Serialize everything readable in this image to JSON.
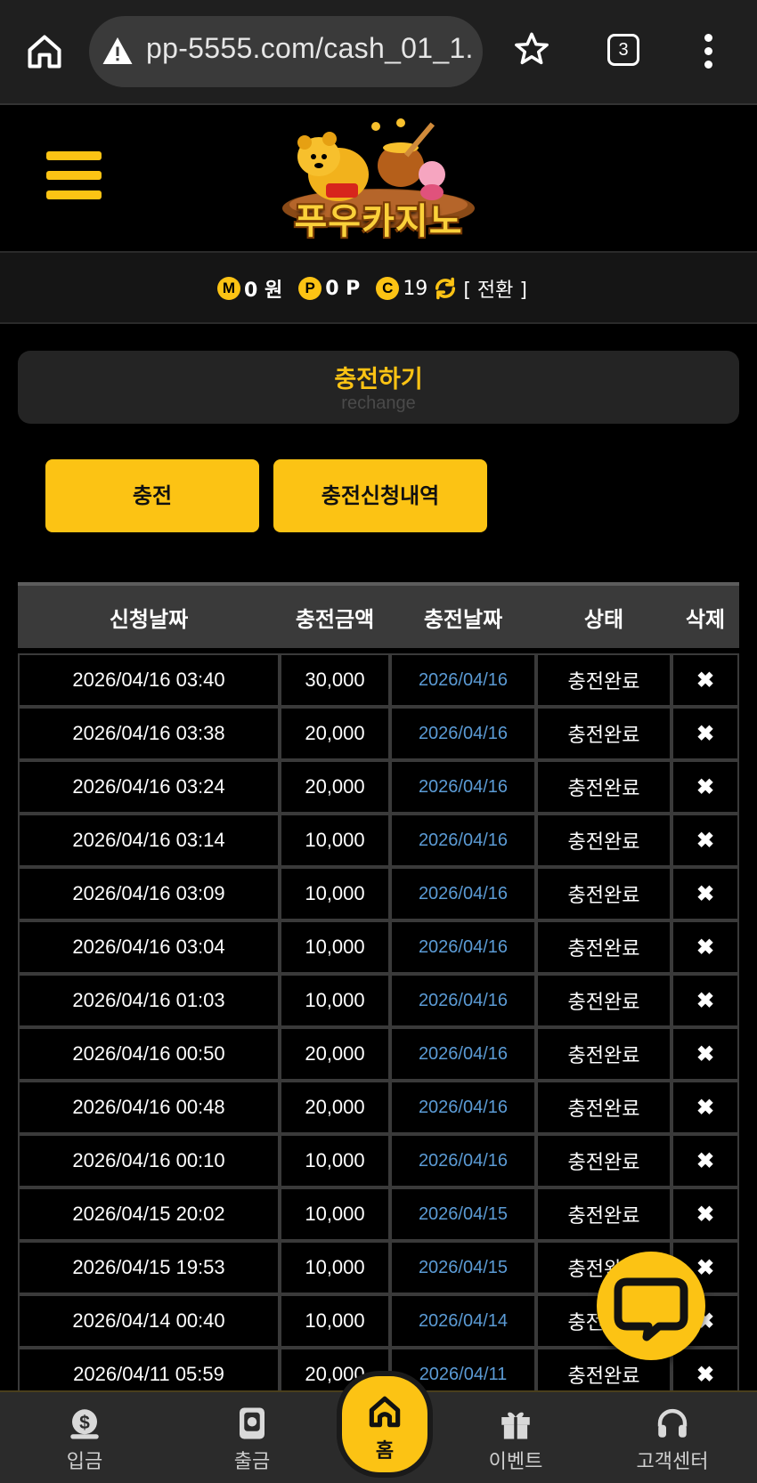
{
  "browser": {
    "url": "pp-5555.com/cash_01_1.",
    "tab_count": "3"
  },
  "site": {
    "logo_text": "푸우카지노"
  },
  "balance": {
    "money_icon": "M",
    "money_value": "0 원",
    "point_icon": "P",
    "point_value": "0 P",
    "coupon_icon": "C",
    "coupon_value": "19",
    "convert_label": "[ 전환 ]"
  },
  "page": {
    "title": "충전하기",
    "subtitle": "rechange"
  },
  "tabs": {
    "charge_label": "충전",
    "history_label": "충전신청내역"
  },
  "table": {
    "headers": [
      "신청날짜",
      "충전금액",
      "충전날짜",
      "상태",
      "삭제"
    ],
    "rows": [
      {
        "request_date": "2026/04/16 03:40",
        "amount": "30,000",
        "charge_date": "2026/04/16",
        "status": "충전완료",
        "delete": "✖"
      },
      {
        "request_date": "2026/04/16 03:38",
        "amount": "20,000",
        "charge_date": "2026/04/16",
        "status": "충전완료",
        "delete": "✖"
      },
      {
        "request_date": "2026/04/16 03:24",
        "amount": "20,000",
        "charge_date": "2026/04/16",
        "status": "충전완료",
        "delete": "✖"
      },
      {
        "request_date": "2026/04/16 03:14",
        "amount": "10,000",
        "charge_date": "2026/04/16",
        "status": "충전완료",
        "delete": "✖"
      },
      {
        "request_date": "2026/04/16 03:09",
        "amount": "10,000",
        "charge_date": "2026/04/16",
        "status": "충전완료",
        "delete": "✖"
      },
      {
        "request_date": "2026/04/16 03:04",
        "amount": "10,000",
        "charge_date": "2026/04/16",
        "status": "충전완료",
        "delete": "✖"
      },
      {
        "request_date": "2026/04/16 01:03",
        "amount": "10,000",
        "charge_date": "2026/04/16",
        "status": "충전완료",
        "delete": "✖"
      },
      {
        "request_date": "2026/04/16 00:50",
        "amount": "20,000",
        "charge_date": "2026/04/16",
        "status": "충전완료",
        "delete": "✖"
      },
      {
        "request_date": "2026/04/16 00:48",
        "amount": "20,000",
        "charge_date": "2026/04/16",
        "status": "충전완료",
        "delete": "✖"
      },
      {
        "request_date": "2026/04/16 00:10",
        "amount": "10,000",
        "charge_date": "2026/04/16",
        "status": "충전완료",
        "delete": "✖"
      },
      {
        "request_date": "2026/04/15 20:02",
        "amount": "10,000",
        "charge_date": "2026/04/15",
        "status": "충전완료",
        "delete": "✖"
      },
      {
        "request_date": "2026/04/15 19:53",
        "amount": "10,000",
        "charge_date": "2026/04/15",
        "status": "충전완료",
        "delete": "✖"
      },
      {
        "request_date": "2026/04/14 00:40",
        "amount": "10,000",
        "charge_date": "2026/04/14",
        "status": "충전완료",
        "delete": "✖"
      },
      {
        "request_date": "2026/04/11 05:59",
        "amount": "20,000",
        "charge_date": "2026/04/11",
        "status": "충전완료",
        "delete": "✖"
      }
    ]
  },
  "bottom_nav": {
    "deposit": "입금",
    "withdraw": "출금",
    "home": "홈",
    "event": "이벤트",
    "support": "고객센터"
  },
  "colors": {
    "accent": "#fcc314",
    "date_link": "#5b9bd5",
    "background": "#000000"
  },
  "icons": {
    "browser_home": "home-icon",
    "url_warning": "warning-icon",
    "bookmark": "star-icon",
    "tabs": "tabs-icon",
    "browser_menu": "more-vert-icon",
    "site_menu": "hamburger-icon",
    "refresh": "refresh-icon",
    "chat": "chat-icon",
    "deposit": "money-bag-icon",
    "withdraw": "wallet-icon",
    "home": "home-icon",
    "event": "gift-icon",
    "support": "headset-icon"
  }
}
